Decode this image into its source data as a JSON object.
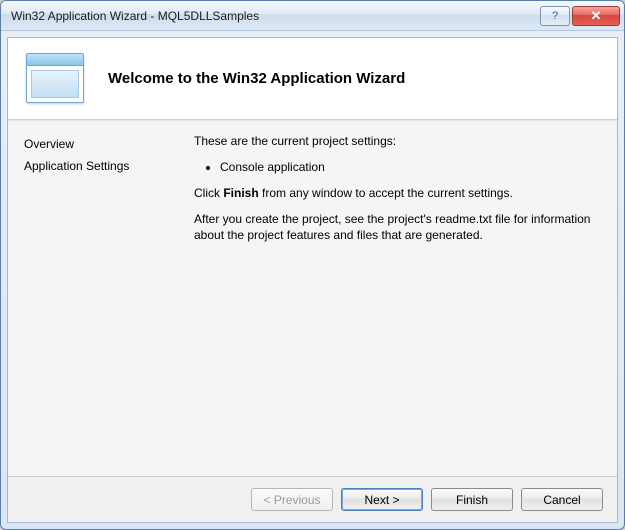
{
  "window": {
    "title": "Win32 Application Wizard - MQL5DLLSamples",
    "help_symbol": "?",
    "close_symbol": "✕"
  },
  "header": {
    "title": "Welcome to the Win32 Application Wizard"
  },
  "sidebar": {
    "items": [
      {
        "label": "Overview"
      },
      {
        "label": "Application Settings"
      }
    ]
  },
  "content": {
    "intro": "These are the current project settings:",
    "bullets": [
      "Console application"
    ],
    "click_prefix": "Click ",
    "click_bold": "Finish",
    "click_suffix": " from any window to accept the current settings.",
    "note": "After you create the project, see the project's readme.txt file for information about the project features and files that are generated."
  },
  "footer": {
    "previous": "< Previous",
    "next": "Next >",
    "finish": "Finish",
    "cancel": "Cancel"
  }
}
